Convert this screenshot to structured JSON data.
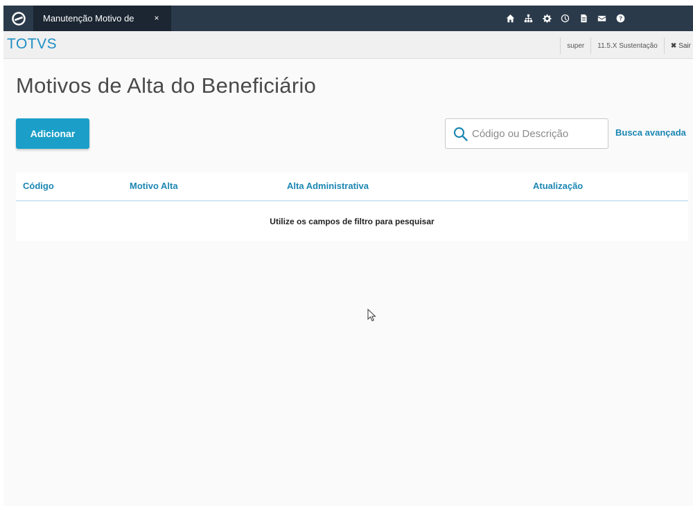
{
  "topbar": {
    "tab_label": "Manutenção Motivo de",
    "tab_close": "×",
    "icons": [
      "home-icon",
      "sitemap-icon",
      "settings-icon",
      "clock-icon",
      "document-icon",
      "mail-icon",
      "help-icon"
    ]
  },
  "brandbar": {
    "brand": "TOTVS",
    "user": "super",
    "environment": "11.5.X Sustentação",
    "logout_label": "Sair",
    "logout_icon": "✖"
  },
  "page": {
    "title": "Motivos de Alta do Beneficiário",
    "add_button": "Adicionar",
    "search_placeholder": "Código ou Descrição",
    "advanced_search": "Busca avançada"
  },
  "table": {
    "columns": [
      "Código",
      "Motivo Alta",
      "Alta Administrativa",
      "Atualização"
    ],
    "empty_message": "Utilize os campos de filtro para pesquisar"
  },
  "colors": {
    "topbar": "#2b3a4a",
    "active_tab": "#1b2632",
    "brand": "#1d8fc4",
    "primary_button": "#1b9fc8",
    "link": "#1b86b3"
  }
}
